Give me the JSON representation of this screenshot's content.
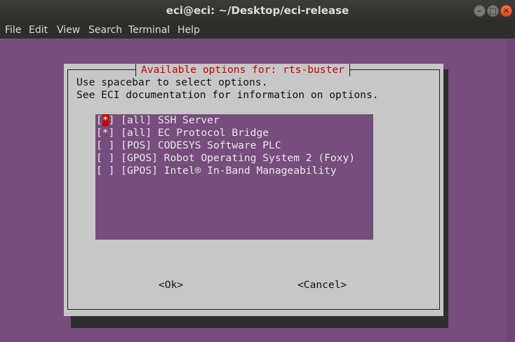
{
  "window": {
    "title": "eci@eci: ~/Desktop/eci-release",
    "controls": {
      "minimize": "–",
      "maximize": "□",
      "close": "✕"
    }
  },
  "menubar": [
    "File",
    "Edit",
    "View",
    "Search",
    "Terminal",
    "Help"
  ],
  "dialog": {
    "title": "Available options for: rts-buster",
    "instructions": [
      "Use spacebar to select options.",
      "See ECI documentation for information on options."
    ],
    "options": [
      {
        "open": "[",
        "mark": "*",
        "close": "]",
        "label": " [all] SSH Server"
      },
      {
        "open": "[",
        "mark": "*",
        "close": "]",
        "label": " [all] EC Protocol Bridge"
      },
      {
        "open": "[",
        "mark": " ",
        "close": "]",
        "label": " [POS] CODESYS Software PLC"
      },
      {
        "open": "[",
        "mark": " ",
        "close": "]",
        "label": " [GPOS] Robot Operating System 2 (Foxy)"
      },
      {
        "open": "[",
        "mark": " ",
        "close": "]",
        "label": " [GPOS] Intel® In-Band Manageability"
      }
    ],
    "buttons": {
      "ok": "<Ok>",
      "cancel": "<Cancel>"
    }
  },
  "colors": {
    "terminal_bg": "#764d7c",
    "dialog_bg": "#c7c7c7",
    "title_text": "#cc0000",
    "cursor": "#cc0000"
  }
}
